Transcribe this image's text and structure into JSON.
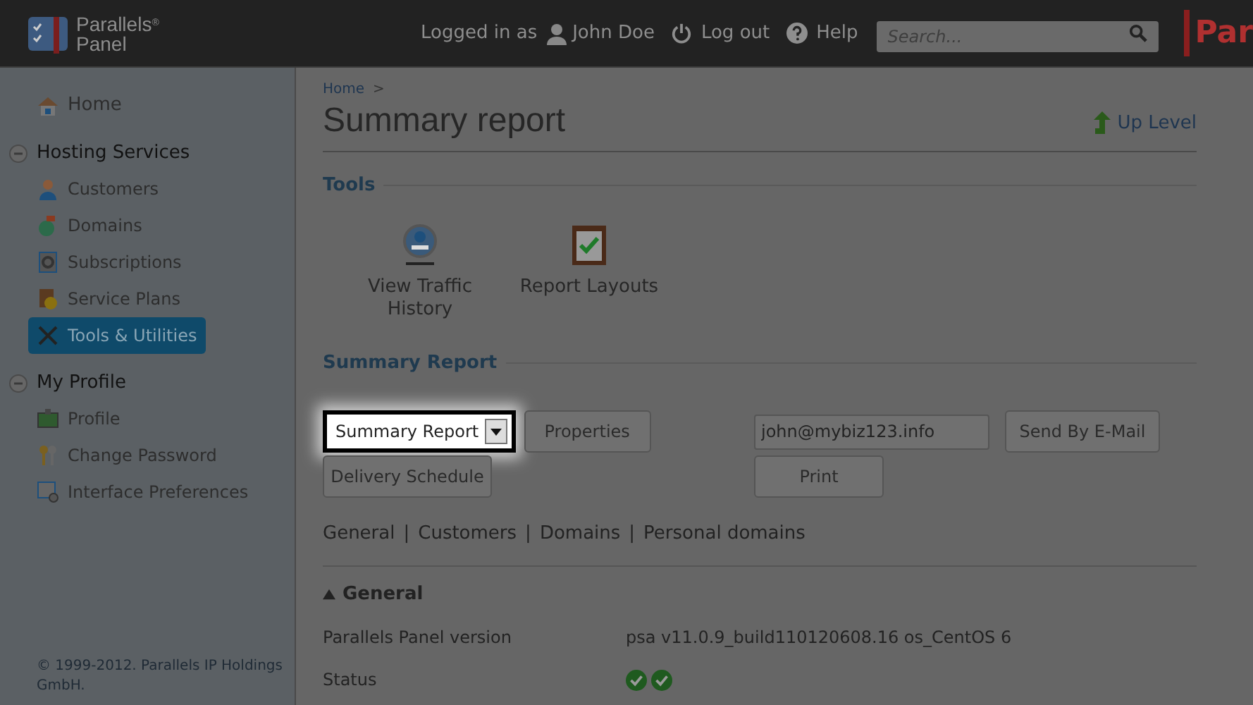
{
  "header": {
    "logo": {
      "line1": "Parallels",
      "mark": "®",
      "line2": "Panel"
    },
    "logged_in_label": "Logged in as",
    "user": "John Doe",
    "logout": "Log out",
    "help": "Help",
    "search": {
      "placeholder": "Search..."
    },
    "brand_cut": "Par"
  },
  "sidebar": {
    "home": "Home",
    "groups": [
      {
        "title": "Hosting Services",
        "expanded": true,
        "items": [
          {
            "label": "Customers",
            "kind": "person",
            "selected": false
          },
          {
            "label": "Domains",
            "kind": "globe",
            "selected": false
          },
          {
            "label": "Subscriptions",
            "kind": "gear",
            "selected": false
          },
          {
            "label": "Service Plans",
            "kind": "coin",
            "selected": false
          },
          {
            "label": "Tools & Utilities",
            "kind": "tools",
            "selected": true
          }
        ]
      },
      {
        "title": "My Profile",
        "expanded": true,
        "items": [
          {
            "label": "Profile",
            "kind": "card",
            "selected": false
          },
          {
            "label": "Change Password",
            "kind": "keys",
            "selected": false
          },
          {
            "label": "Interface Preferences",
            "kind": "window",
            "selected": false
          }
        ]
      }
    ],
    "copyright": "© 1999-2012. Parallels IP Holdings GmbH."
  },
  "breadcrumb": [
    "Home"
  ],
  "breadcrumb_sep": ">",
  "title": "Summary report",
  "up_level": "Up Level",
  "tools": {
    "heading": "Tools",
    "items": [
      {
        "label": "View Traffic History",
        "kind": "traffic"
      },
      {
        "label": "Report Layouts",
        "kind": "report"
      }
    ]
  },
  "summary": {
    "heading": "Summary Report",
    "layout_select": "Summary Report",
    "properties": "Properties",
    "delivery": "Delivery Schedule",
    "email": "john@mybiz123.info",
    "send": "Send By E-Mail",
    "print": "Print"
  },
  "sections": {
    "links": [
      "General",
      "Customers",
      "Domains",
      "Personal domains"
    ],
    "sep": "|"
  },
  "general": {
    "title": "General",
    "expanded": true,
    "rows": [
      {
        "label": "Parallels Panel version",
        "kind": "text",
        "value": "psa v11.0.9_build110120608.16 os_CentOS 6"
      },
      {
        "label": "Status",
        "kind": "icons",
        "icons": [
          {
            "kind": "check"
          },
          {
            "kind": "check"
          }
        ]
      }
    ]
  }
}
